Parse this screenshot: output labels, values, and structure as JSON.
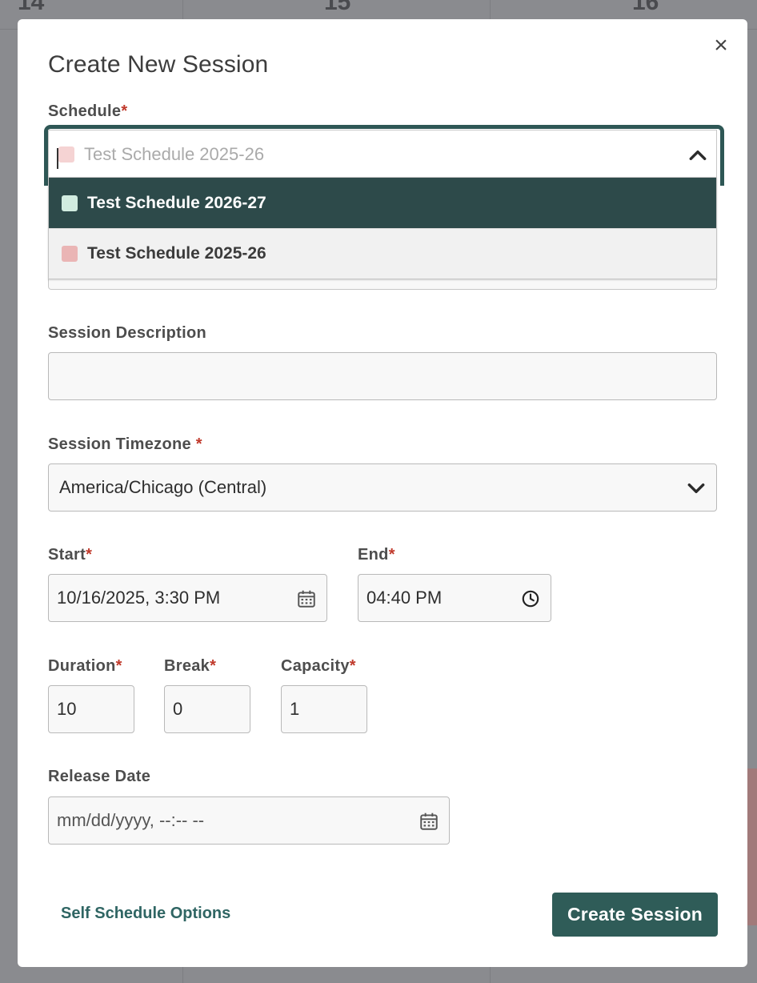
{
  "backdrop": {
    "day_numbers": [
      "14",
      "15",
      "16"
    ]
  },
  "modal": {
    "title": "Create New Session",
    "close_icon": "close-icon"
  },
  "schedule": {
    "label": "Schedule",
    "required_mark": "*",
    "value": "Test Schedule 2025-26",
    "value_color": "#f5d3d3",
    "options": [
      {
        "label": "Test Schedule 2026-27",
        "color": "#d1ece0",
        "state": "highlighted"
      },
      {
        "label": "Test Schedule 2025-26",
        "color": "#eab5b5",
        "state": "selected"
      }
    ]
  },
  "description": {
    "label": "Session Description",
    "value": ""
  },
  "timezone": {
    "label": "Session Timezone",
    "required_mark": "*",
    "value": "America/Chicago (Central)"
  },
  "start": {
    "label": "Start",
    "required_mark": "*",
    "value": "10/16/2025, 3:30 PM"
  },
  "end": {
    "label": "End",
    "required_mark": "*",
    "value": "04:40 PM"
  },
  "duration": {
    "label": "Duration",
    "required_mark": "*",
    "value": "10"
  },
  "break": {
    "label": "Break",
    "required_mark": "*",
    "value": "0"
  },
  "capacity": {
    "label": "Capacity",
    "required_mark": "*",
    "value": "1"
  },
  "release_date": {
    "label": "Release Date",
    "placeholder": "mm/dd/yyyy, --:-- --"
  },
  "footer": {
    "self_schedule_link": "Self Schedule Options",
    "create_button": "Create Session"
  },
  "colors": {
    "accent": "#2f5c58",
    "active_option": "#2d4a4a",
    "required": "#c0392b"
  }
}
